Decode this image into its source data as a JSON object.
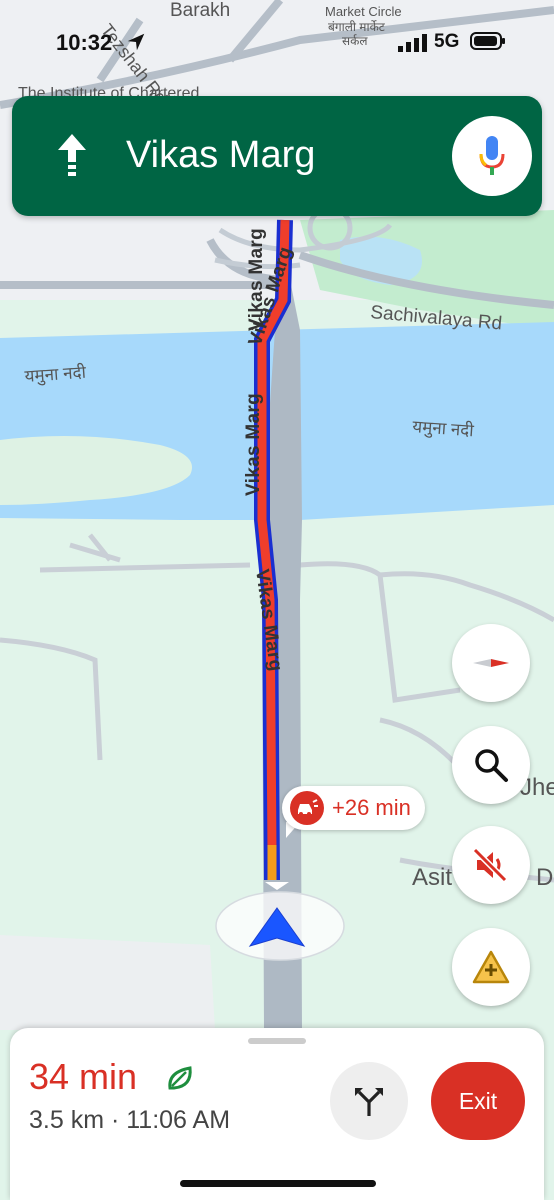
{
  "status_bar": {
    "time": "10:32",
    "network": "5G"
  },
  "map": {
    "labels": {
      "top_area_1": "Barakh",
      "top_area_2": "Tezshah Rd",
      "top_area_3": "The Institute of Chartered",
      "market_1": "Market Circle",
      "market_2": "बंगाली मार्केट",
      "market_3": "सर्कल",
      "sachivalaya": "Sachivalaya Rd",
      "river_left": "यमुना नदी",
      "river_right": "यमुना नदी",
      "road_1": "Vikas Marg",
      "road_2": "Vikas Marg",
      "road_3": "Vikas Marg",
      "road_4": "Vikas Marg",
      "poi_right": "Jhe",
      "poi_right2": "Asit",
      "poi_right3": "D"
    }
  },
  "header": {
    "street": "Vikas Marg",
    "direction_icon": "straight-arrow-icon",
    "mic_icon": "microphone-icon"
  },
  "traffic": {
    "delay": "+26 min"
  },
  "fabs": [
    "compass-icon",
    "search-icon",
    "mute-icon",
    "report-incident-icon"
  ],
  "trip": {
    "duration": "34 min",
    "details": "3.5 km · 11:06 AM",
    "exit_label": "Exit"
  },
  "colors": {
    "header_bg": "#006544",
    "traffic_red": "#d93025",
    "water": "#aadaff",
    "park": "#c7efd6",
    "route_blue": "#1a56ff"
  }
}
